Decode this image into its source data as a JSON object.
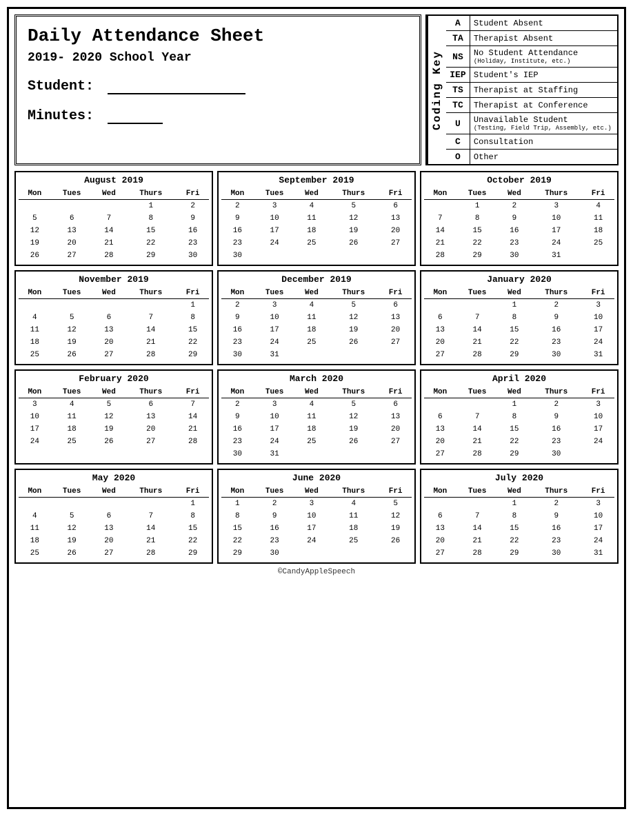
{
  "page": {
    "title_line1": "Daily Attendance Sheet",
    "title_line2": "2019- 2020 School Year",
    "student_label": "Student:",
    "minutes_label": "Minutes:",
    "footer": "©CandyAppleSpeech"
  },
  "coding_key": {
    "label": "Coding Key",
    "items": [
      {
        "code": "A",
        "desc": "Student Absent",
        "sub": ""
      },
      {
        "code": "TA",
        "desc": "Therapist Absent",
        "sub": ""
      },
      {
        "code": "NS",
        "desc": "No Student Attendance",
        "sub": "(Holiday, Institute, etc.)"
      },
      {
        "code": "IEP",
        "desc": "Student's IEP",
        "sub": ""
      },
      {
        "code": "TS",
        "desc": "Therapist at Staffing",
        "sub": ""
      },
      {
        "code": "TC",
        "desc": "Therapist at Conference",
        "sub": ""
      },
      {
        "code": "U",
        "desc": "Unavailable Student",
        "sub": "(Testing, Field Trip, Assembly, etc.)"
      },
      {
        "code": "C",
        "desc": "Consultation",
        "sub": ""
      },
      {
        "code": "O",
        "desc": "Other",
        "sub": ""
      }
    ]
  },
  "calendars": [
    {
      "title": "August 2019",
      "days": [
        "Mon",
        "Tues",
        "Wed",
        "Thurs",
        "Fri"
      ],
      "weeks": [
        [
          "",
          "",
          "",
          "1",
          "2"
        ],
        [
          "5",
          "6",
          "7",
          "8",
          "9"
        ],
        [
          "12",
          "13",
          "14",
          "15",
          "16"
        ],
        [
          "19",
          "20",
          "21",
          "22",
          "23"
        ],
        [
          "26",
          "27",
          "28",
          "29",
          "30"
        ]
      ]
    },
    {
      "title": "September 2019",
      "days": [
        "Mon",
        "Tues",
        "Wed",
        "Thurs",
        "Fri"
      ],
      "weeks": [
        [
          "2",
          "3",
          "4",
          "5",
          "6"
        ],
        [
          "9",
          "10",
          "11",
          "12",
          "13"
        ],
        [
          "16",
          "17",
          "18",
          "19",
          "20"
        ],
        [
          "23",
          "24",
          "25",
          "26",
          "27"
        ],
        [
          "30",
          "",
          "",
          "",
          ""
        ]
      ]
    },
    {
      "title": "October 2019",
      "days": [
        "Mon",
        "Tues",
        "Wed",
        "Thurs",
        "Fri"
      ],
      "weeks": [
        [
          "",
          "1",
          "2",
          "3",
          "4"
        ],
        [
          "7",
          "8",
          "9",
          "10",
          "11"
        ],
        [
          "14",
          "15",
          "16",
          "17",
          "18"
        ],
        [
          "21",
          "22",
          "23",
          "24",
          "25"
        ],
        [
          "28",
          "29",
          "30",
          "31",
          ""
        ]
      ]
    },
    {
      "title": "November 2019",
      "days": [
        "Mon",
        "Tues",
        "Wed",
        "Thurs",
        "Fri"
      ],
      "weeks": [
        [
          "",
          "",
          "",
          "",
          "1"
        ],
        [
          "4",
          "5",
          "6",
          "7",
          "8"
        ],
        [
          "11",
          "12",
          "13",
          "14",
          "15"
        ],
        [
          "18",
          "19",
          "20",
          "21",
          "22"
        ],
        [
          "25",
          "26",
          "27",
          "28",
          "29"
        ]
      ]
    },
    {
      "title": "December 2019",
      "days": [
        "Mon",
        "Tues",
        "Wed",
        "Thurs",
        "Fri"
      ],
      "weeks": [
        [
          "2",
          "3",
          "4",
          "5",
          "6"
        ],
        [
          "9",
          "10",
          "11",
          "12",
          "13"
        ],
        [
          "16",
          "17",
          "18",
          "19",
          "20"
        ],
        [
          "23",
          "24",
          "25",
          "26",
          "27"
        ],
        [
          "30",
          "31",
          "",
          "",
          ""
        ]
      ]
    },
    {
      "title": "January 2020",
      "days": [
        "Mon",
        "Tues",
        "Wed",
        "Thurs",
        "Fri"
      ],
      "weeks": [
        [
          "",
          "",
          "1",
          "2",
          "3"
        ],
        [
          "6",
          "7",
          "8",
          "9",
          "10"
        ],
        [
          "13",
          "14",
          "15",
          "16",
          "17"
        ],
        [
          "20",
          "21",
          "22",
          "23",
          "24"
        ],
        [
          "27",
          "28",
          "29",
          "30",
          "31"
        ]
      ]
    },
    {
      "title": "February 2020",
      "days": [
        "Mon",
        "Tues",
        "Wed",
        "Thurs",
        "Fri"
      ],
      "weeks": [
        [
          "3",
          "4",
          "5",
          "6",
          "7"
        ],
        [
          "10",
          "11",
          "12",
          "13",
          "14"
        ],
        [
          "17",
          "18",
          "19",
          "20",
          "21"
        ],
        [
          "24",
          "25",
          "26",
          "27",
          "28"
        ],
        [
          "",
          "",
          "",
          "",
          ""
        ]
      ]
    },
    {
      "title": "March 2020",
      "days": [
        "Mon",
        "Tues",
        "Wed",
        "Thurs",
        "Fri"
      ],
      "weeks": [
        [
          "2",
          "3",
          "4",
          "5",
          "6"
        ],
        [
          "9",
          "10",
          "11",
          "12",
          "13"
        ],
        [
          "16",
          "17",
          "18",
          "19",
          "20"
        ],
        [
          "23",
          "24",
          "25",
          "26",
          "27"
        ],
        [
          "30",
          "31",
          "",
          "",
          ""
        ]
      ]
    },
    {
      "title": "April 2020",
      "days": [
        "Mon",
        "Tues",
        "Wed",
        "Thurs",
        "Fri"
      ],
      "weeks": [
        [
          "",
          "",
          "1",
          "2",
          "3"
        ],
        [
          "6",
          "7",
          "8",
          "9",
          "10"
        ],
        [
          "13",
          "14",
          "15",
          "16",
          "17"
        ],
        [
          "20",
          "21",
          "22",
          "23",
          "24"
        ],
        [
          "27",
          "28",
          "29",
          "30",
          ""
        ]
      ]
    },
    {
      "title": "May 2020",
      "days": [
        "Mon",
        "Tues",
        "Wed",
        "Thurs",
        "Fri"
      ],
      "weeks": [
        [
          "",
          "",
          "",
          "",
          "1"
        ],
        [
          "4",
          "5",
          "6",
          "7",
          "8"
        ],
        [
          "11",
          "12",
          "13",
          "14",
          "15"
        ],
        [
          "18",
          "19",
          "20",
          "21",
          "22"
        ],
        [
          "25",
          "26",
          "27",
          "28",
          "29"
        ]
      ]
    },
    {
      "title": "June 2020",
      "days": [
        "Mon",
        "Tues",
        "Wed",
        "Thurs",
        "Fri"
      ],
      "weeks": [
        [
          "1",
          "2",
          "3",
          "4",
          "5"
        ],
        [
          "8",
          "9",
          "10",
          "11",
          "12"
        ],
        [
          "15",
          "16",
          "17",
          "18",
          "19"
        ],
        [
          "22",
          "23",
          "24",
          "25",
          "26"
        ],
        [
          "29",
          "30",
          "",
          "",
          ""
        ]
      ]
    },
    {
      "title": "July 2020",
      "days": [
        "Mon",
        "Tues",
        "Wed",
        "Thurs",
        "Fri"
      ],
      "weeks": [
        [
          "",
          "",
          "1",
          "2",
          "3"
        ],
        [
          "6",
          "7",
          "8",
          "9",
          "10"
        ],
        [
          "13",
          "14",
          "15",
          "16",
          "17"
        ],
        [
          "20",
          "21",
          "22",
          "23",
          "24"
        ],
        [
          "27",
          "28",
          "29",
          "30",
          "31"
        ]
      ]
    }
  ]
}
